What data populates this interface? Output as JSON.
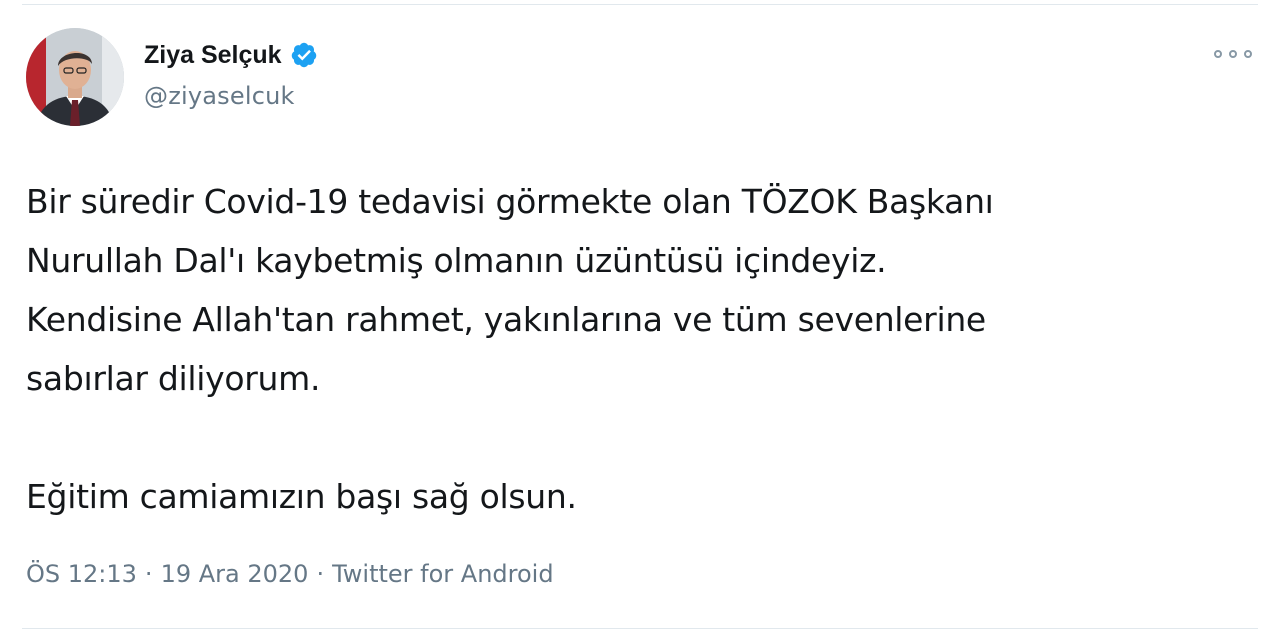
{
  "tweet": {
    "author": {
      "display_name": "Ziya Selçuk",
      "handle": "@ziyaselcuk",
      "verified": true
    },
    "icons": {
      "verified": "verified-badge-icon",
      "more": "more-options-icon"
    },
    "paragraphs": [
      [
        "Bir süredir Covid-19 tedavisi görmekte olan TÖZOK Başkanı",
        "Nurullah Dal'ı kaybetmiş olmanın üzüntüsü içindeyiz.",
        "Kendisine Allah'tan rahmet, yakınlarına ve tüm sevenlerine",
        "sabırlar diliyorum."
      ],
      [
        "Eğitim camiamızın başı sağ olsun."
      ]
    ],
    "meta": {
      "time": "ÖS 12:13",
      "separator": "·",
      "date": "19 Ara 2020",
      "source": "Twitter for Android"
    },
    "colors": {
      "verified_blue": "#1da1f2",
      "text": "#14171a",
      "secondary": "#657786",
      "divider": "#e1e8ed"
    }
  }
}
